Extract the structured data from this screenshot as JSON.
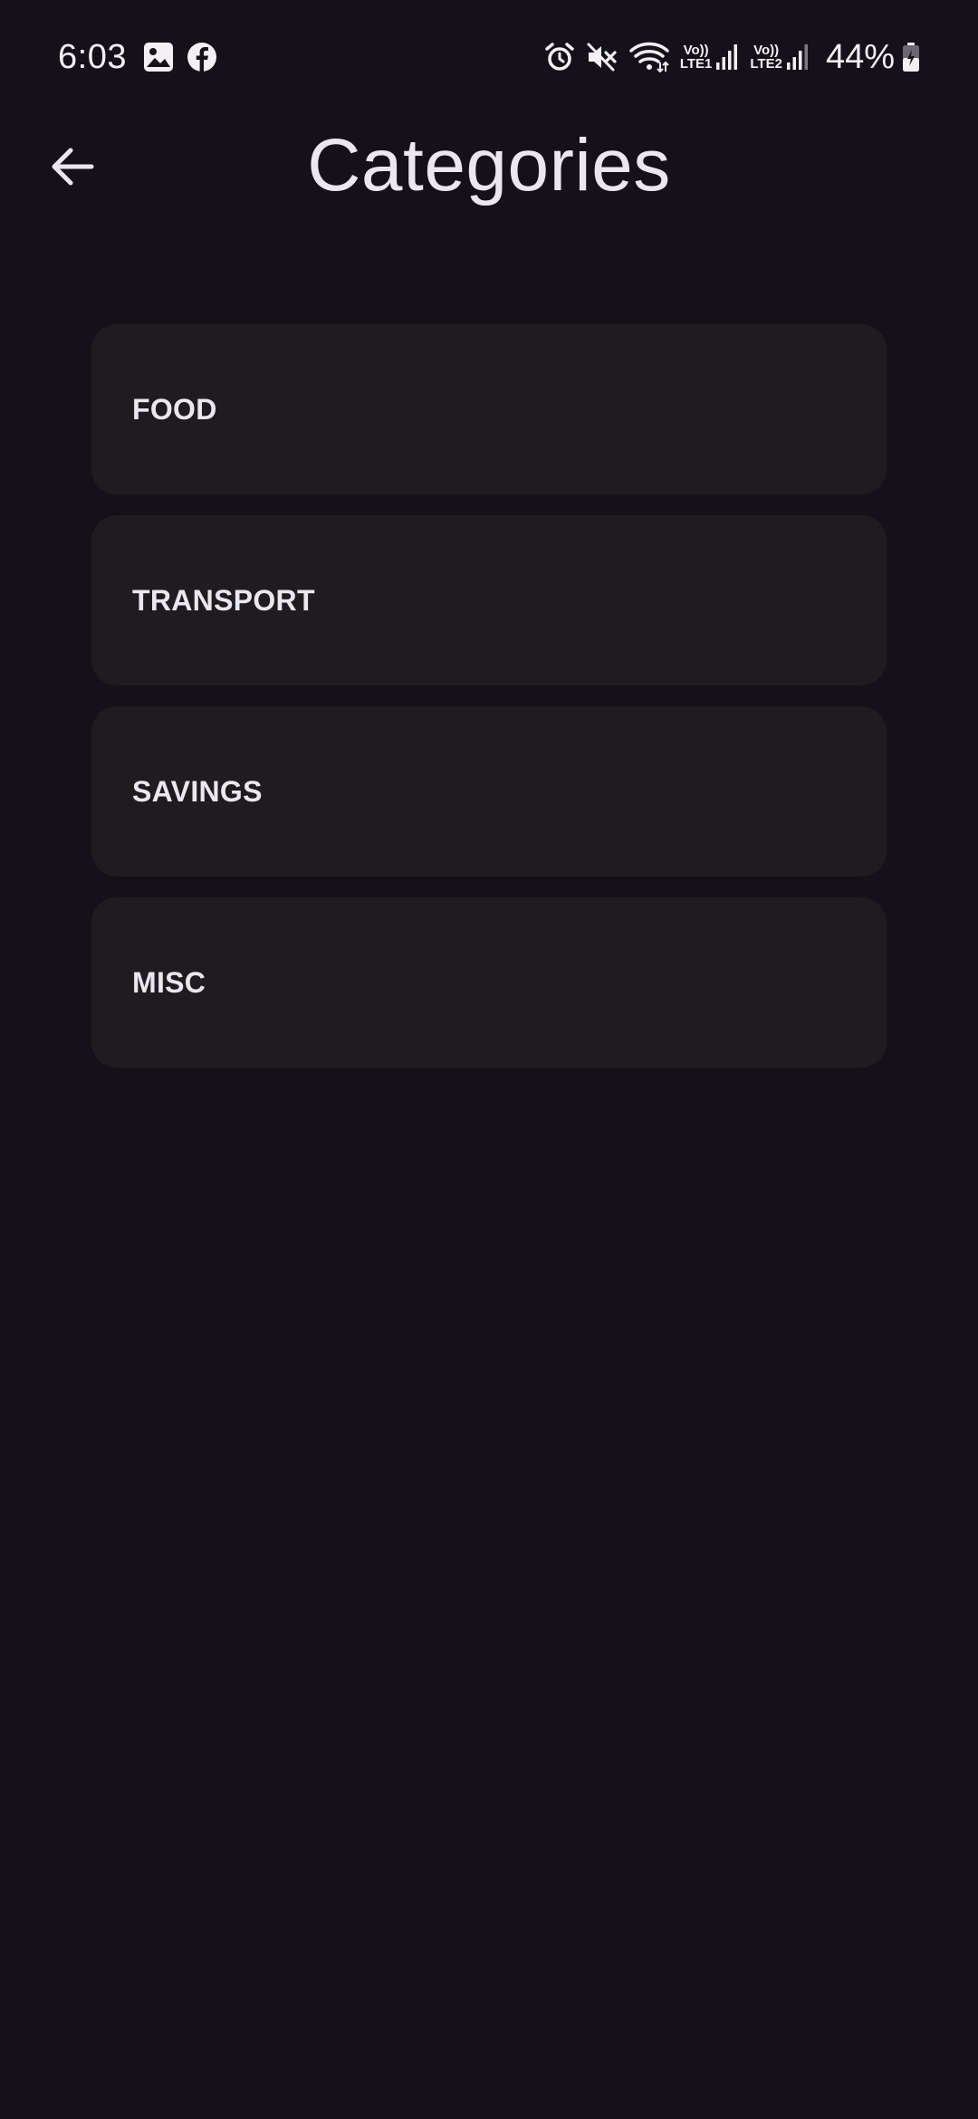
{
  "status_bar": {
    "time": "6:03",
    "battery_percent": "44%",
    "sim1": {
      "top": "Vo))",
      "bottom": "LTE1"
    },
    "sim2": {
      "top": "Vo))",
      "bottom": "LTE2"
    },
    "icons_left": [
      "gallery-icon",
      "facebook-icon"
    ],
    "icons_right": [
      "alarm-icon",
      "mute-icon",
      "wifi-icon",
      "signal-icon",
      "signal-icon",
      "battery-icon"
    ]
  },
  "header": {
    "title": "Categories",
    "back_icon": "arrow-left-icon"
  },
  "categories": [
    {
      "label": "FOOD"
    },
    {
      "label": "TRANSPORT"
    },
    {
      "label": "SAVINGS"
    },
    {
      "label": "MISC"
    }
  ],
  "colors": {
    "background": "#141118",
    "card": "#1e1c21",
    "text": "#ebe7ef"
  }
}
